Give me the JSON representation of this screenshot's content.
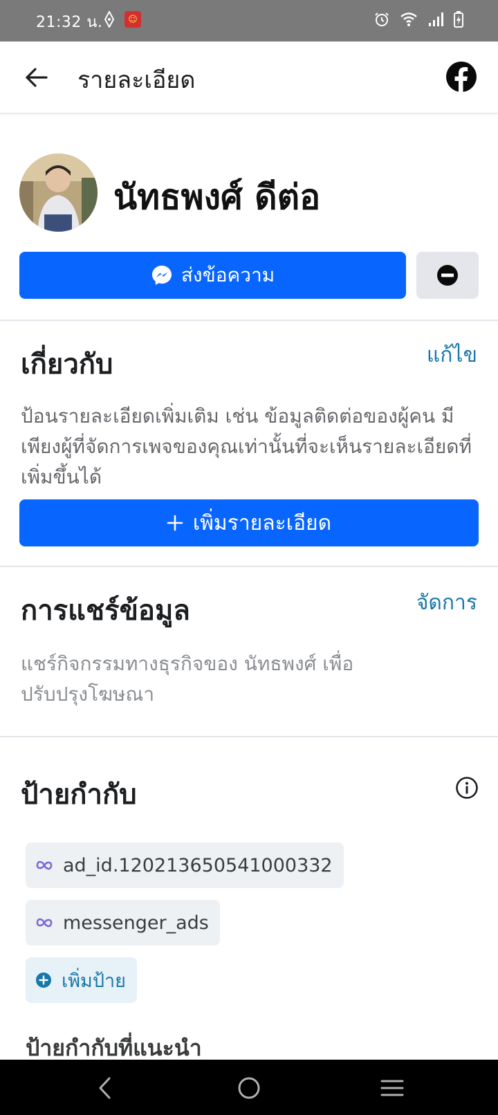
{
  "status_bar": {
    "time": "21:32 น.",
    "icons": [
      "nav-diamond-icon",
      "app-badge-icon",
      "alarm-icon",
      "wifi-icon",
      "signal-icon",
      "battery-charging-icon"
    ]
  },
  "app_bar": {
    "title": "รายละเอียด",
    "back_icon": "arrow-left-icon",
    "logo": "facebook-logo"
  },
  "profile": {
    "name": "นัทธพงศ์ ดีต่อ"
  },
  "actions": {
    "message_label": "ส่งข้อความ",
    "message_icon": "messenger-icon",
    "block_icon": "block-icon",
    "accent_color": "#0866ff"
  },
  "about": {
    "title": "เกี่ยวกับ",
    "edit_label": "แก้ไข",
    "description": "ป้อนรายละเอียดเพิ่มเติม เช่น ข้อมูลติดต่อของผู้คน มีเพียงผู้ที่จัดการเพจของคุณเท่านั้นที่จะเห็นรายละเอียดที่เพิ่มขึ้นได้",
    "add_details_label": "เพิ่มรายละเอียด"
  },
  "data_sharing": {
    "title": "การแชร์ข้อมูล",
    "manage_label": "จัดการ",
    "description": "แชร์กิจกรรมทางธุรกิจของ นัทธพงศ์ เพื่อปรับปรุงโฆษณา"
  },
  "labels": {
    "title": "ป้ายกำกับ",
    "info_icon": "info-icon",
    "tags": [
      {
        "text": "ad_id.120213650541000332",
        "icon": "meta-infinity-icon"
      },
      {
        "text": "messenger_ads",
        "icon": "meta-infinity-icon"
      }
    ],
    "add_label": "เพิ่มป้าย",
    "suggested_title": "ป้ายกำกับที่แนะนำ"
  },
  "nav_bar": {
    "buttons": [
      "back-nav-icon",
      "home-nav-icon",
      "recents-nav-icon"
    ]
  }
}
